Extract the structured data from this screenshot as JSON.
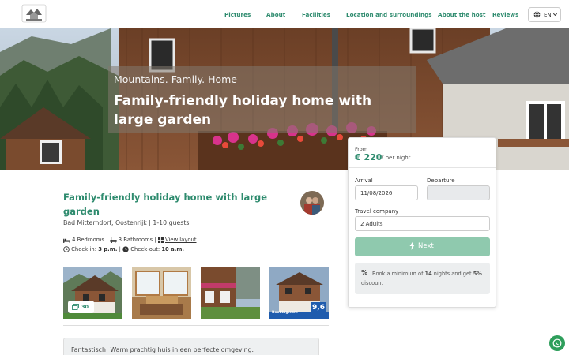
{
  "nav": {
    "logo_icon": "house-mountain-logo",
    "links": [
      "Pictures",
      "About",
      "Facilities",
      "Location and surroundings",
      "About the host",
      "Reviews"
    ],
    "language": "EN"
  },
  "hero": {
    "subtitle": "Mountains. Family. Home",
    "title": "Family-friendly holiday home with large garden"
  },
  "booking": {
    "from_label": "From",
    "price": "€ 220",
    "per_night": "/ per night",
    "arrival_label": "Arrival",
    "arrival_value": "11/08/2026",
    "departure_label": "Departure",
    "departure_value": "",
    "company_label": "Travel company",
    "company_value": "2 Adults",
    "next_label": "Next",
    "promo_prefix": "Book a minimum of ",
    "promo_nights": "14",
    "promo_middle": " nights and get ",
    "promo_discount": "5%",
    "promo_suffix": " discount",
    "accent": "#2e8b6e",
    "button_color": "#8fc9ae"
  },
  "listing": {
    "title": "Family-friendly holiday home with large garden",
    "location": "Bad Mitterndorf, Oostenrijk | 1-10 guests",
    "bedrooms": "4 Bedrooms",
    "bathrooms": "3 Bathrooms",
    "view_layout": "View layout",
    "checkin_label": "Check-in: ",
    "checkin_time": "3 p.m.",
    "checkout_label": "Check-out: ",
    "checkout_time": "10 a.m.",
    "photo_count": "30",
    "booking_score": "9,6",
    "booking_brand": "Booking.com",
    "review_text": "Fantastisch! Warm prachtig huis in een perfecte omgeving."
  }
}
